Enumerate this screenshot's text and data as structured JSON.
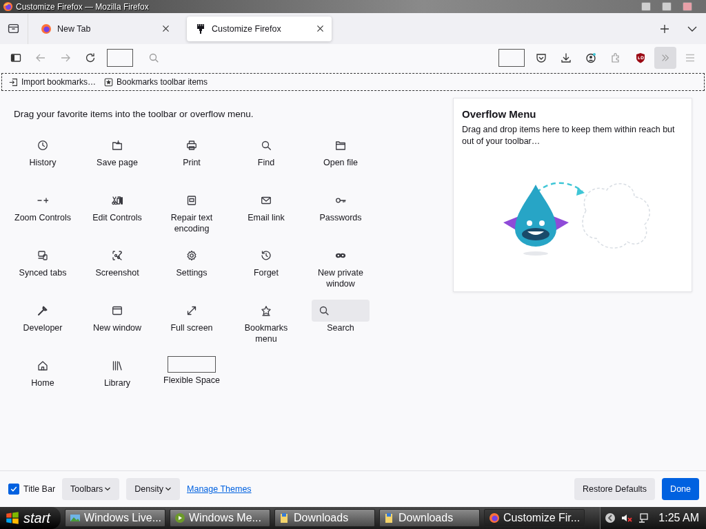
{
  "window": {
    "title": "Customize Firefox — Mozilla Firefox"
  },
  "tabs": [
    {
      "label": "New Tab",
      "selected": false
    },
    {
      "label": "Customize Firefox",
      "selected": true
    }
  ],
  "bookmarks_toolbar": [
    "Import bookmarks…",
    "Bookmarks toolbar items"
  ],
  "palette": {
    "heading": "Drag your favorite items into the toolbar or overflow menu.",
    "items": [
      {
        "label": "History",
        "kind": "button"
      },
      {
        "label": "Save page",
        "kind": "button"
      },
      {
        "label": "Print",
        "kind": "button"
      },
      {
        "label": "Find",
        "kind": "button"
      },
      {
        "label": "Open file",
        "kind": "button"
      },
      {
        "label": "Zoom Controls",
        "kind": "button"
      },
      {
        "label": "Edit Controls",
        "kind": "button"
      },
      {
        "label": "Repair text encoding",
        "kind": "button"
      },
      {
        "label": "Email link",
        "kind": "button"
      },
      {
        "label": "Passwords",
        "kind": "button"
      },
      {
        "label": "Synced tabs",
        "kind": "button"
      },
      {
        "label": "Screenshot",
        "kind": "button"
      },
      {
        "label": "Settings",
        "kind": "button"
      },
      {
        "label": "Forget",
        "kind": "button"
      },
      {
        "label": "New private window",
        "kind": "button"
      },
      {
        "label": "Developer",
        "kind": "button"
      },
      {
        "label": "New window",
        "kind": "button"
      },
      {
        "label": "Full screen",
        "kind": "button"
      },
      {
        "label": "Bookmarks menu",
        "kind": "button"
      },
      {
        "label": "Search",
        "kind": "search"
      },
      {
        "label": "Home",
        "kind": "button"
      },
      {
        "label": "Library",
        "kind": "button"
      },
      {
        "label": "Flexible Space",
        "kind": "spacer"
      }
    ]
  },
  "overflow_panel": {
    "title": "Overflow Menu",
    "description": "Drag and drop items here to keep them within reach but out of your toolbar…"
  },
  "footer": {
    "title_bar": {
      "label": "Title Bar",
      "checked": true
    },
    "dropdowns": [
      "Toolbars",
      "Density"
    ],
    "link": "Manage Themes",
    "buttons": [
      {
        "label": "Restore Defaults",
        "kind": "default"
      },
      {
        "label": "Done",
        "kind": "primary"
      }
    ]
  },
  "taskbar": {
    "start": "start",
    "tasks": [
      {
        "label": "Windows Live...",
        "selected": false
      },
      {
        "label": "Windows Me...",
        "selected": false
      },
      {
        "label": "Downloads",
        "selected": false
      },
      {
        "label": "Downloads",
        "selected": false
      },
      {
        "label": "Customize Fir...",
        "selected": true
      }
    ],
    "clock": "1:25 AM"
  }
}
